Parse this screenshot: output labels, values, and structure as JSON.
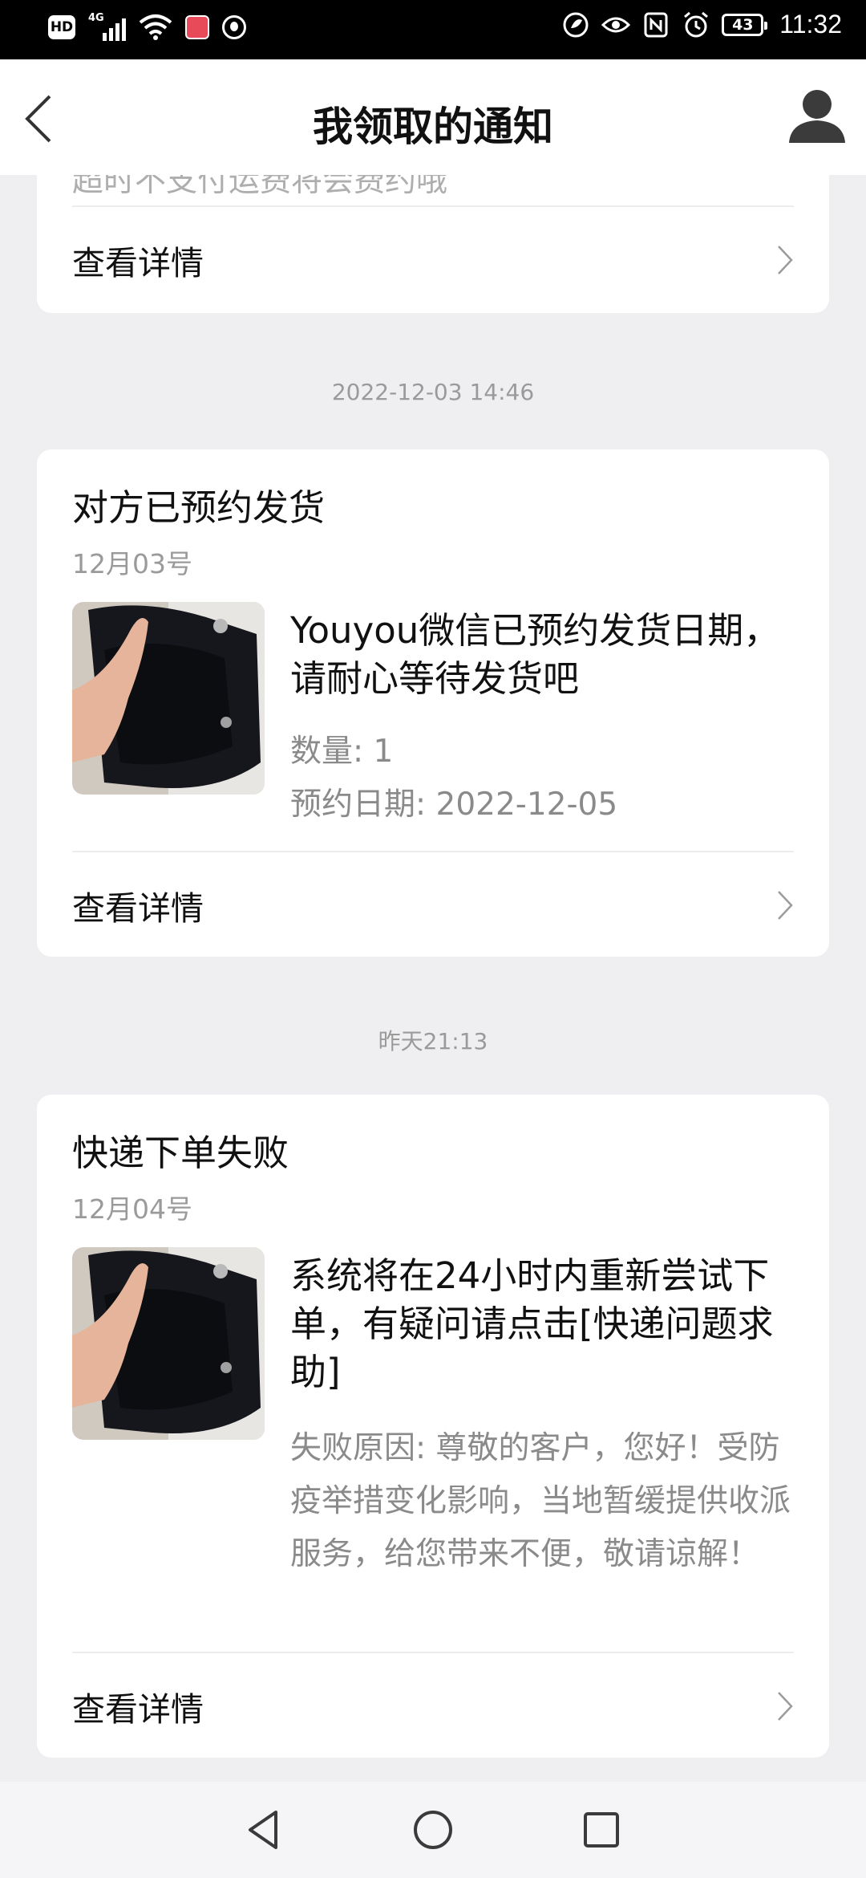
{
  "status_bar": {
    "hd": "HD",
    "network": "4G",
    "battery": "43",
    "time": "11:32"
  },
  "header": {
    "title": "我领取的通知",
    "back_icon": "chevron-left-icon",
    "profile_icon": "user-avatar-icon"
  },
  "cards": [
    {
      "partial_text": "超时不支付运费将会费约哦",
      "view_label": "查看详情"
    },
    {
      "timestamp": "2022-12-03 14:46",
      "title": "对方已预约发货",
      "date": "12月03号",
      "message": "Youyou微信已预约发货日期，请耐心等待发货吧",
      "quantity": "数量: 1",
      "reserve_date": "预约日期: 2022-12-05",
      "view_label": "查看详情"
    },
    {
      "timestamp": "昨天21:13",
      "title": "快递下单失败",
      "date": "12月04号",
      "message": "系统将在24小时内重新尝试下单，有疑问请点击[快递问题求助]",
      "reason": "失败原因: 尊敬的客户，您好！受防疫举措变化影响，当地暂缓提供收派服务，给您带来不便，敬请谅解！",
      "view_label": "查看详情"
    }
  ],
  "nav_bar": {
    "back": "triangle-back-icon",
    "home": "circle-home-icon",
    "recent": "square-recent-icon"
  }
}
